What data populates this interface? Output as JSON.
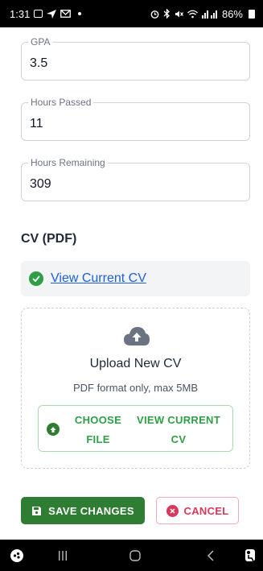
{
  "status_bar": {
    "time": "1:31",
    "battery": "86%"
  },
  "fields": [
    {
      "label": "GPA",
      "value": "3.5"
    },
    {
      "label": "Hours Passed",
      "value": "11"
    },
    {
      "label": "Hours Remaining",
      "value": "309"
    }
  ],
  "cv": {
    "section_title": "CV (PDF)",
    "current_link": "View Current CV",
    "upload_title": "Upload New CV",
    "upload_hint": "PDF format only, max 5MB",
    "choose_file_label": "CHOOSE FILE",
    "view_current_label": "VIEW CURRENT CV"
  },
  "actions": {
    "save_label": "SAVE CHANGES",
    "cancel_label": "CANCEL"
  },
  "colors": {
    "primary_green": "#2e7d32",
    "success_green": "#2e9e47",
    "link_blue": "#1d5fd6",
    "cancel_red": "#d63a5a"
  },
  "icons": [
    "check-circle-icon",
    "cloud-upload-icon",
    "save-icon",
    "close-circle-icon",
    "recent-apps-icon",
    "home-icon",
    "back-icon"
  ]
}
